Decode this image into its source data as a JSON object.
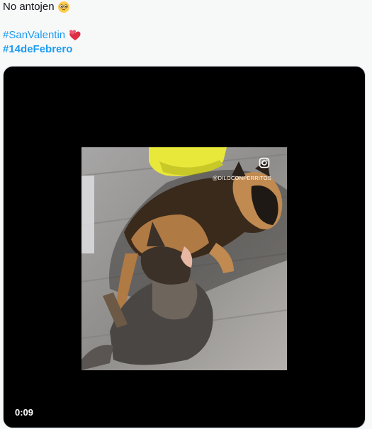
{
  "tweet": {
    "text_line": "No antojen",
    "pleading_emoji": "pleading-face-emoji",
    "heart_emoji": "two-hearts-emoji",
    "hashtags": [
      {
        "label": "#SanValentin"
      },
      {
        "label": "#14deFebrero"
      }
    ]
  },
  "media": {
    "duration": "0:09",
    "watermark": "@DILOCONPERRITOS",
    "watermark_icon": "instagram-icon"
  },
  "colors": {
    "link": "#1d9bf0",
    "background": "#f7f9f9",
    "media_bg": "#000000"
  }
}
